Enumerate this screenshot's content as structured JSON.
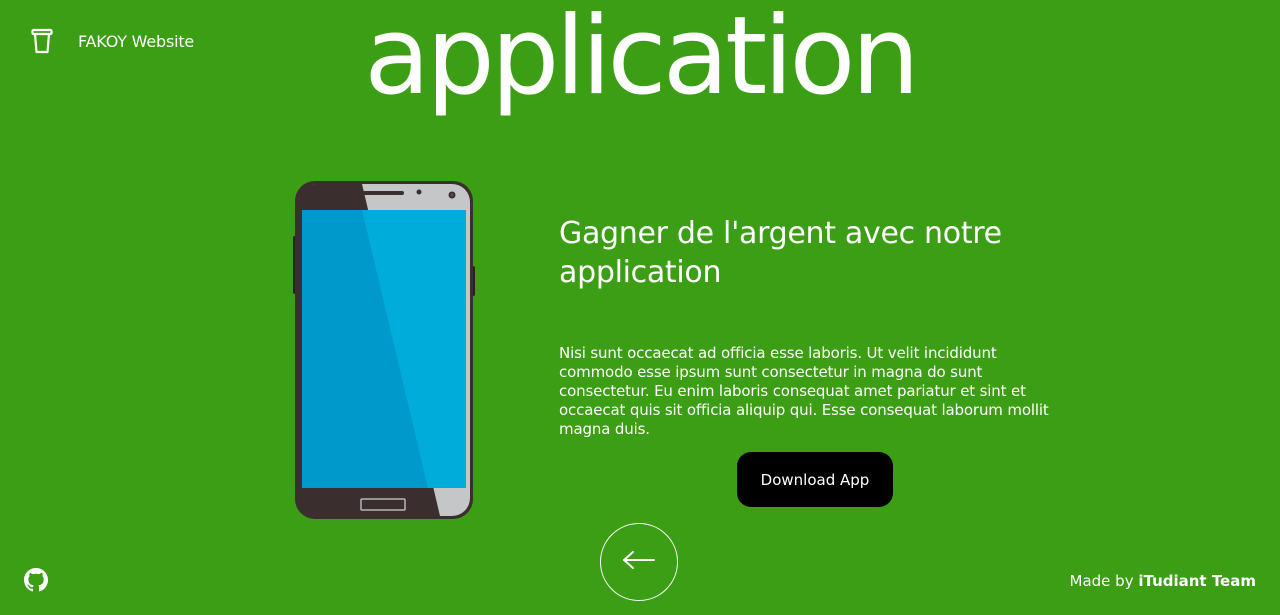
{
  "header": {
    "brand_label": "FAKOY Website",
    "brand_icon": "trash-bin-icon"
  },
  "hero": {
    "title": "application"
  },
  "content": {
    "heading": "Gagner de l'argent avec notre application",
    "paragraph": "Nisi sunt occaecat ad officia esse laboris. Ut velit incididunt commodo esse ipsum sunt consectetur in magna do sunt consectetur. Eu enim laboris consequat amet pariatur et sint et occaecat quis sit officia aliquip qui. Esse consequat laborum mollit magna duis.",
    "download_label": "Download App"
  },
  "navigation": {
    "back_icon": "arrow-left-icon"
  },
  "footer": {
    "github_icon": "github-icon",
    "credit_prefix": "Made by ",
    "credit_team": "iTudiant Team"
  },
  "colors": {
    "background": "#3c9e14",
    "button": "#000000",
    "screen": "#00a9d6",
    "phone_body": "#3a2e2e"
  }
}
